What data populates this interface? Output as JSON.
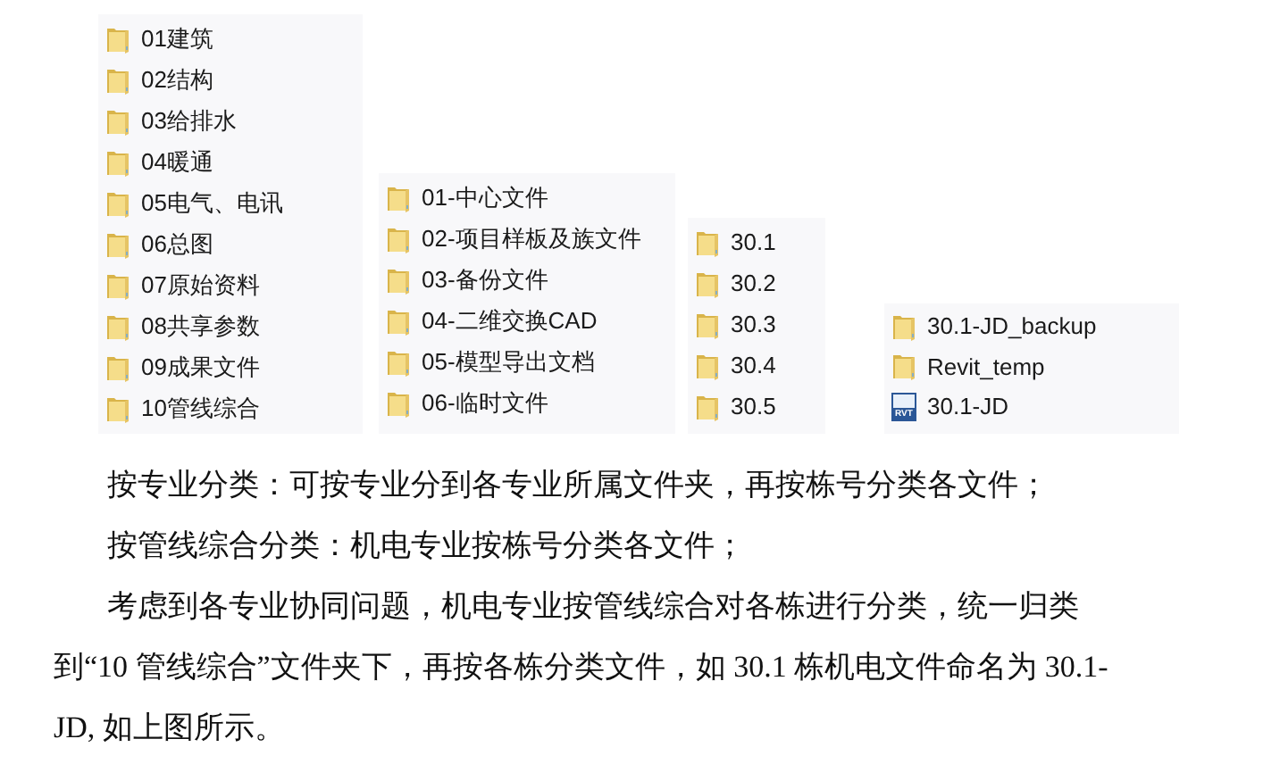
{
  "folder_lists": [
    {
      "items": [
        {
          "kind": "folder",
          "name": "01建筑"
        },
        {
          "kind": "folder",
          "name": "02结构"
        },
        {
          "kind": "folder",
          "name": "03给排水"
        },
        {
          "kind": "folder",
          "name": "04暖通"
        },
        {
          "kind": "folder",
          "name": "05电气、电讯"
        },
        {
          "kind": "folder",
          "name": "06总图"
        },
        {
          "kind": "folder",
          "name": "07原始资料"
        },
        {
          "kind": "folder",
          "name": "08共享参数"
        },
        {
          "kind": "folder",
          "name": "09成果文件"
        },
        {
          "kind": "folder",
          "name": "10管线综合"
        }
      ]
    },
    {
      "items": [
        {
          "kind": "folder",
          "name": "01-中心文件"
        },
        {
          "kind": "folder",
          "name": "02-项目样板及族文件"
        },
        {
          "kind": "folder",
          "name": "03-备份文件"
        },
        {
          "kind": "folder",
          "name": "04-二维交换CAD"
        },
        {
          "kind": "folder",
          "name": "05-模型导出文档"
        },
        {
          "kind": "folder",
          "name": "06-临时文件"
        }
      ]
    },
    {
      "items": [
        {
          "kind": "folder",
          "name": "30.1"
        },
        {
          "kind": "folder",
          "name": "30.2"
        },
        {
          "kind": "folder",
          "name": "30.3"
        },
        {
          "kind": "folder",
          "name": "30.4"
        },
        {
          "kind": "folder",
          "name": "30.5"
        }
      ]
    },
    {
      "items": [
        {
          "kind": "folder",
          "name": "30.1-JD_backup"
        },
        {
          "kind": "folder",
          "name": "Revit_temp"
        },
        {
          "kind": "file",
          "name": "30.1-JD",
          "icon_label": "RVT"
        }
      ]
    }
  ],
  "paragraphs": [
    {
      "text": "按专业分类：可按专业分到各专业所属文件夹，再按栋号分类各文件；"
    },
    {
      "text": "按管线综合分类：机电专业按栋号分类各文件；"
    },
    {
      "text": "考虑到各专业协同问题，机电专业按管线综合对各栋进行分类，统一归类到“10 管线综合”文件夹下，再按各栋分类文件，如 30.1 栋机电文件命名为 30.1-JD, 如上图所示。"
    }
  ]
}
